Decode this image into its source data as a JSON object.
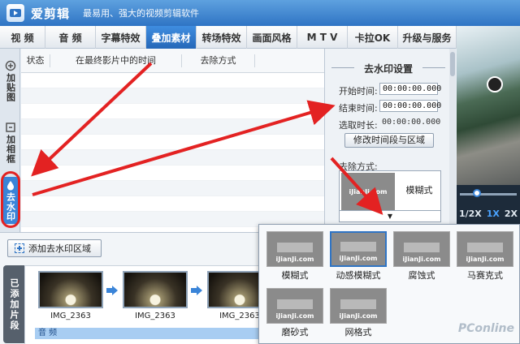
{
  "window": {
    "app_name": "爱剪辑",
    "slogan": "最易用、强大的视频剪辑软件"
  },
  "tabs": [
    {
      "label": "视 频",
      "w": 56
    },
    {
      "label": "音 频",
      "w": 62
    },
    {
      "label": "字幕特效",
      "w": 62
    },
    {
      "label": "叠加素材",
      "w": 62,
      "active": true
    },
    {
      "label": "转场特效",
      "w": 62
    },
    {
      "label": "画面风格",
      "w": 62
    },
    {
      "label": "M T V",
      "w": 62
    },
    {
      "label": "卡拉OK",
      "w": 62
    },
    {
      "label": "升级与服务",
      "w": 72
    }
  ],
  "sidebar": {
    "items": [
      {
        "label": "加贴图",
        "icon": "sticker-icon"
      },
      {
        "label": "加相框",
        "icon": "frame-icon"
      },
      {
        "label": "去水印",
        "icon": "watermark-icon",
        "active": true
      }
    ]
  },
  "table": {
    "headers": [
      "状态",
      "在最终影片中的时间",
      "去除方式"
    ]
  },
  "settings": {
    "title": "去水印设置",
    "start_label": "开始时间:",
    "start_value": "00:00:00.000",
    "end_label": "结束时间:",
    "end_value": "00:00:00.000",
    "duration_label": "选取时长:",
    "duration_value": "00:00:00.000",
    "modify_button": "修改时间段与区域",
    "method_label": "去除方式:",
    "method_value": "模糊式",
    "thumb_mark": "iJianJi.com",
    "dropdown_glyph": "▼"
  },
  "preview": {
    "speeds": [
      "1/2X",
      "1X",
      "2X"
    ],
    "active_speed": "1X"
  },
  "bottom": {
    "add_button": "添加去水印区域",
    "added_tab": "已添加片段",
    "clips": [
      "IMG_2363",
      "IMG_2363",
      "IMG_2363"
    ],
    "audio_label": "音 频"
  },
  "popup": {
    "styles": [
      {
        "name": "模糊式"
      },
      {
        "name": "动感模糊式",
        "selected": true
      },
      {
        "name": "腐蚀式"
      },
      {
        "name": "马赛克式"
      },
      {
        "name": "磨砂式"
      },
      {
        "name": "网格式"
      }
    ],
    "mark": "iJianJi.com",
    "brand": "PConline"
  },
  "colors": {
    "accent": "#2f74c4",
    "annotation_red": "#e32222"
  }
}
